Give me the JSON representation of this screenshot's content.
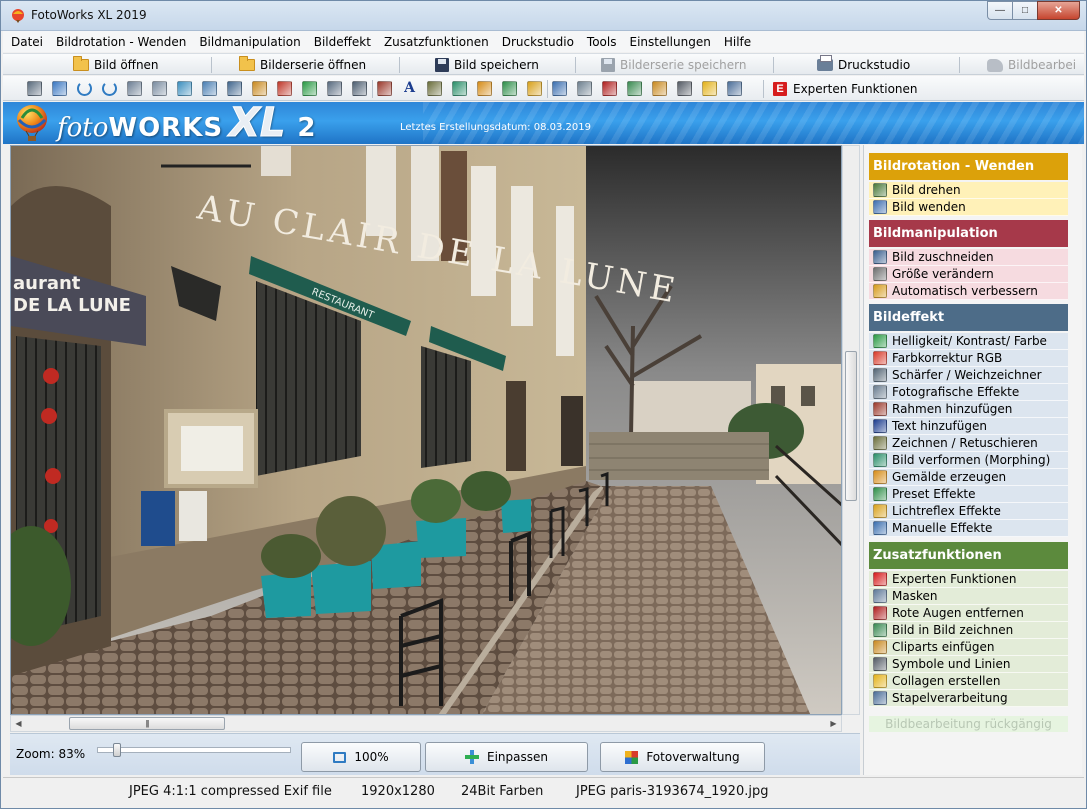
{
  "window": {
    "title": "FotoWorks XL 2019",
    "minimize": "—",
    "maximize": "□",
    "close": "✕"
  },
  "menu": [
    "Datei",
    "Bildrotation - Wenden",
    "Bildmanipulation",
    "Bildeffekt",
    "Zusatzfunktionen",
    "Druckstudio",
    "Tools",
    "Einstellungen",
    "Hilfe"
  ],
  "toolbar": {
    "open_image": "Bild öffnen",
    "open_series": "Bilderserie öffnen",
    "save_image": "Bild speichern",
    "save_series": "Bilderserie speichern",
    "print_studio": "Druckstudio",
    "image_edit": "Bildbearbei"
  },
  "icon_toolbar": {
    "expert_label": "Experten Funktionen",
    "expert_glyph": "E",
    "text_glyph": "A",
    "icons": [
      "crop-corner-icon",
      "resize-corner-icon",
      "rotate-left-icon",
      "rotate-right-icon",
      "mirror-icon",
      "flip-icon",
      "wave-icon",
      "scissors-icon",
      "resize-icon",
      "magic-wand-icon",
      "brightness-icon",
      "color-icon",
      "sharpen-icon",
      "camera-icon",
      "frame-icon",
      "text-icon",
      "retouch-icon",
      "morph-icon",
      "paint-icon",
      "preset-icon",
      "lightreflex-icon",
      "manual-icon",
      "mask-icon",
      "red-eye-icon",
      "picture-in-picture-icon",
      "clipart-icon",
      "symbols-icon",
      "collage-icon",
      "batch-icon"
    ]
  },
  "banner": {
    "logo_foto": "foto",
    "logo_works": "WORKS",
    "logo_xl": "XL",
    "logo_version": "2",
    "build_date": "Letztes Erstellungsdatum: 08.03.2019"
  },
  "colors": {
    "rotation": "#dca10a",
    "manipulation": "#a6394a",
    "effect": "#4d6c88",
    "extras": "#5c8a3d"
  },
  "panel": {
    "sections": [
      {
        "title": "Bildrotation - Wenden",
        "items": [
          {
            "label": "Bild drehen",
            "icon": "rotate-image-icon"
          },
          {
            "label": "Bild wenden",
            "icon": "flip-image-icon"
          }
        ]
      },
      {
        "title": "Bildmanipulation",
        "items": [
          {
            "label": "Bild zuschneiden",
            "icon": "scissors-icon"
          },
          {
            "label": "Größe verändern",
            "icon": "resize-icon"
          },
          {
            "label": "Automatisch verbessern",
            "icon": "magic-wand-icon"
          }
        ]
      },
      {
        "title": "Bildeffekt",
        "items": [
          {
            "label": "Helligkeit/ Kontrast/ Farbe",
            "icon": "brightness-icon"
          },
          {
            "label": "Farbkorrektur RGB",
            "icon": "rgb-icon"
          },
          {
            "label": "Schärfer / Weichzeichner",
            "icon": "sharpen-icon"
          },
          {
            "label": "Fotografische Effekte",
            "icon": "camera-icon"
          },
          {
            "label": "Rahmen hinzufügen",
            "icon": "frame-icon"
          },
          {
            "label": "Text hinzufügen",
            "icon": "text-icon"
          },
          {
            "label": "Zeichnen / Retuschieren",
            "icon": "retouch-icon"
          },
          {
            "label": "Bild verformen (Morphing)",
            "icon": "morph-icon"
          },
          {
            "label": "Gemälde erzeugen",
            "icon": "paint-icon"
          },
          {
            "label": "Preset Effekte",
            "icon": "preset-icon"
          },
          {
            "label": "Lichtreflex Effekte",
            "icon": "lightreflex-icon"
          },
          {
            "label": "Manuelle Effekte",
            "icon": "manual-icon"
          }
        ]
      },
      {
        "title": "Zusatzfunktionen",
        "items": [
          {
            "label": "Experten Funktionen",
            "icon": "expert-icon"
          },
          {
            "label": "Masken",
            "icon": "mask-icon"
          },
          {
            "label": "Rote Augen entfernen",
            "icon": "red-eye-icon"
          },
          {
            "label": "Bild in Bild zeichnen",
            "icon": "picture-in-picture-icon"
          },
          {
            "label": "Cliparts einfügen",
            "icon": "clipart-icon"
          },
          {
            "label": "Symbole und Linien",
            "icon": "symbols-icon"
          },
          {
            "label": "Collagen erstellen",
            "icon": "collage-icon"
          },
          {
            "label": "Stapelverarbeitung",
            "icon": "batch-icon"
          }
        ]
      }
    ],
    "undo": "Bildbearbeitung rückgängig"
  },
  "photo": {
    "sign_line1": "aurant",
    "sign_line2": "DE LA LUNE",
    "sign_line3": "",
    "facade_text": "AU CLAIR DE LA LUNE",
    "awning_text": "RESTAURANT"
  },
  "scrollbar": {
    "grip": "|||",
    "left_arrow": "◀",
    "right_arrow": "▶"
  },
  "zoom": {
    "label": "Zoom: 83%",
    "value_percent": 83,
    "fraction": 0.085
  },
  "buttons": {
    "zoom_100": "100%",
    "fit": "Einpassen",
    "manager": "Fotoverwaltung"
  },
  "status": {
    "format": "JPEG 4:1:1 compressed Exif file",
    "resolution": "1920x1280",
    "depth": "24Bit Farben",
    "filename": "JPEG paris-3193674_1920.jpg"
  }
}
